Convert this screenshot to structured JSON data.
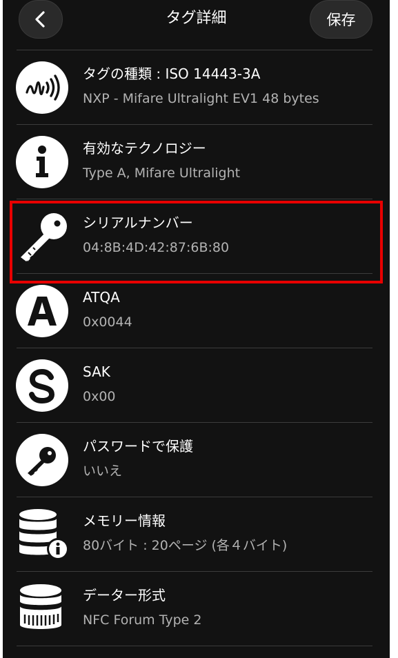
{
  "header": {
    "title": "タグ詳細",
    "save_label": "保存"
  },
  "rows": [
    {
      "icon": "nfc-signal-icon",
      "title": "タグの種類 : ISO 14443-3A",
      "subtitle": "NXP - Mifare Ultralight EV1 48 bytes"
    },
    {
      "icon": "info-icon",
      "title": "有効なテクノロジー",
      "subtitle": "Type A, Mifare Ultralight"
    },
    {
      "icon": "key-icon",
      "title": "シリアルナンバー",
      "subtitle": "04:8B:4D:42:87:6B:80"
    },
    {
      "icon": "letter-a-icon",
      "title": "ATQA",
      "subtitle": "0x0044"
    },
    {
      "icon": "letter-s-icon",
      "title": "SAK",
      "subtitle": "0x00"
    },
    {
      "icon": "password-key-icon",
      "title": "パスワードで保護",
      "subtitle": "いいえ"
    },
    {
      "icon": "memory-info-icon",
      "title": "メモリー情報",
      "subtitle": "80バイト : 20ページ (各４バイト)"
    },
    {
      "icon": "data-format-icon",
      "title": "データー形式",
      "subtitle": "NFC Forum Type 2"
    }
  ],
  "colors": {
    "background": "#121212",
    "text": "#ffffff",
    "subtext": "#b3b3b3",
    "highlight": "#e80000"
  }
}
